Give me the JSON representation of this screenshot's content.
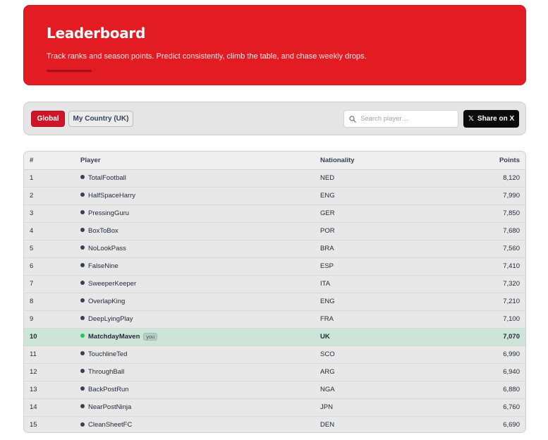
{
  "hero": {
    "title": "Leaderboard",
    "subtitle": "Track ranks and season points. Predict consistently, climb the table, and chase weekly drops.",
    "accent_color": "#e31b23"
  },
  "toolbar": {
    "tabs": [
      {
        "label": "Global",
        "active": true
      },
      {
        "label": "My Country (UK)",
        "active": false
      }
    ],
    "search": {
      "placeholder": "Search player…",
      "value": "",
      "icon": "search-icon"
    },
    "share_label": "Share on X",
    "share_icon": "x-logo-icon"
  },
  "table": {
    "headers": {
      "rank": "#",
      "player": "Player",
      "nationality": "Nationality",
      "points": "Points"
    },
    "rows": [
      {
        "rank": "1",
        "player": "TotalFootball",
        "nationality": "NED",
        "points": "8,120",
        "me": false
      },
      {
        "rank": "2",
        "player": "HalfSpaceHarry",
        "nationality": "ENG",
        "points": "7,990",
        "me": false
      },
      {
        "rank": "3",
        "player": "PressingGuru",
        "nationality": "GER",
        "points": "7,850",
        "me": false
      },
      {
        "rank": "4",
        "player": "BoxToBox",
        "nationality": "POR",
        "points": "7,680",
        "me": false
      },
      {
        "rank": "5",
        "player": "NoLookPass",
        "nationality": "BRA",
        "points": "7,560",
        "me": false
      },
      {
        "rank": "6",
        "player": "FalseNine",
        "nationality": "ESP",
        "points": "7,410",
        "me": false
      },
      {
        "rank": "7",
        "player": "SweeperKeeper",
        "nationality": "ITA",
        "points": "7,320",
        "me": false
      },
      {
        "rank": "8",
        "player": "OverlapKing",
        "nationality": "ENG",
        "points": "7,210",
        "me": false
      },
      {
        "rank": "9",
        "player": "DeepLyingPlay",
        "nationality": "FRA",
        "points": "7,100",
        "me": false
      },
      {
        "rank": "10",
        "player": "MatchdayMaven",
        "nationality": "UK",
        "points": "7,070",
        "me": true,
        "badge": "you"
      },
      {
        "rank": "11",
        "player": "TouchlineTed",
        "nationality": "SCO",
        "points": "6,990",
        "me": false
      },
      {
        "rank": "12",
        "player": "ThroughBall",
        "nationality": "ARG",
        "points": "6,940",
        "me": false
      },
      {
        "rank": "13",
        "player": "BackPostRun",
        "nationality": "NGA",
        "points": "6,880",
        "me": false
      },
      {
        "rank": "14",
        "player": "NearPostNinja",
        "nationality": "JPN",
        "points": "6,760",
        "me": false
      },
      {
        "rank": "15",
        "player": "CleanSheetFC",
        "nationality": "DEN",
        "points": "6,690",
        "me": false
      }
    ]
  }
}
